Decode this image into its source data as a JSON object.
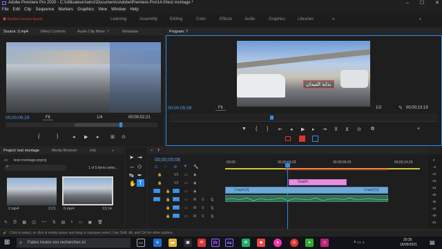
{
  "window": {
    "title": "Adobe Premiere Pro 2020 - C:\\Utilisateurs\\win1\\Documents\\Adobe\\Premiere Pro\\14.0\\test montage *"
  },
  "menu": [
    "File",
    "Edit",
    "Clip",
    "Sequence",
    "Markers",
    "Graphics",
    "View",
    "Window",
    "Help"
  ],
  "status": {
    "system_issues": "System issues found"
  },
  "workspaces": [
    "Learning",
    "Assembly",
    "Editing",
    "Color",
    "Effects",
    "Audio",
    "Graphics",
    "Libraries"
  ],
  "source_panel": {
    "tabs": [
      "Source: 2.mp4",
      "Effect Controls",
      "Audio Clip Mixer: 7",
      "Metadata"
    ],
    "timecode": "00;00;06;19",
    "fit": "Fit",
    "fraction": "1/4",
    "duration": "00;00;02;21"
  },
  "program_panel": {
    "tab": "Program: 7",
    "timecode": "00;00;05;08",
    "fit": "Fit",
    "fraction": "1/2",
    "duration": "00;00;13;19",
    "overlay_text": "بداية الميدان"
  },
  "project_panel": {
    "tabs": [
      "Project: test montage",
      "Media Browser",
      "Info"
    ],
    "file": "test montage.prproj",
    "selection": "1 of 5 items selec...",
    "items": [
      {
        "name": "2.mp4",
        "duration": "2;21"
      },
      {
        "name": "6.mp4",
        "duration": "13;14"
      }
    ]
  },
  "timeline": {
    "tab": "7",
    "timecode": "00;00;05;08",
    "ruler": [
      ";00;00",
      "00;00;04;29",
      "00;00;09;29",
      "00;00;14;29"
    ],
    "tracks": [
      "V3",
      "V2",
      "V1",
      "A1",
      "A2",
      "A3"
    ],
    "clips": {
      "graphic": "Graphi",
      "v1a": "7.mp4 [V]",
      "v1b": "2.mp4 [V]"
    },
    "meter_labels": [
      "0",
      "-6",
      "-12",
      "-18",
      "-24",
      "-30",
      "-36",
      "-42",
      "-48",
      "-54"
    ]
  },
  "statusbar": {
    "hint": "Click to select, or click in empty space and drag to marquee select. Use Shift, Alt, and Ctrl for other options."
  },
  "taskbar": {
    "search_placeholder": "Faites toutes vos recherches ici",
    "time": "20:35",
    "date": "16/05/2021",
    "icons": [
      "Pr",
      "Ae"
    ]
  }
}
